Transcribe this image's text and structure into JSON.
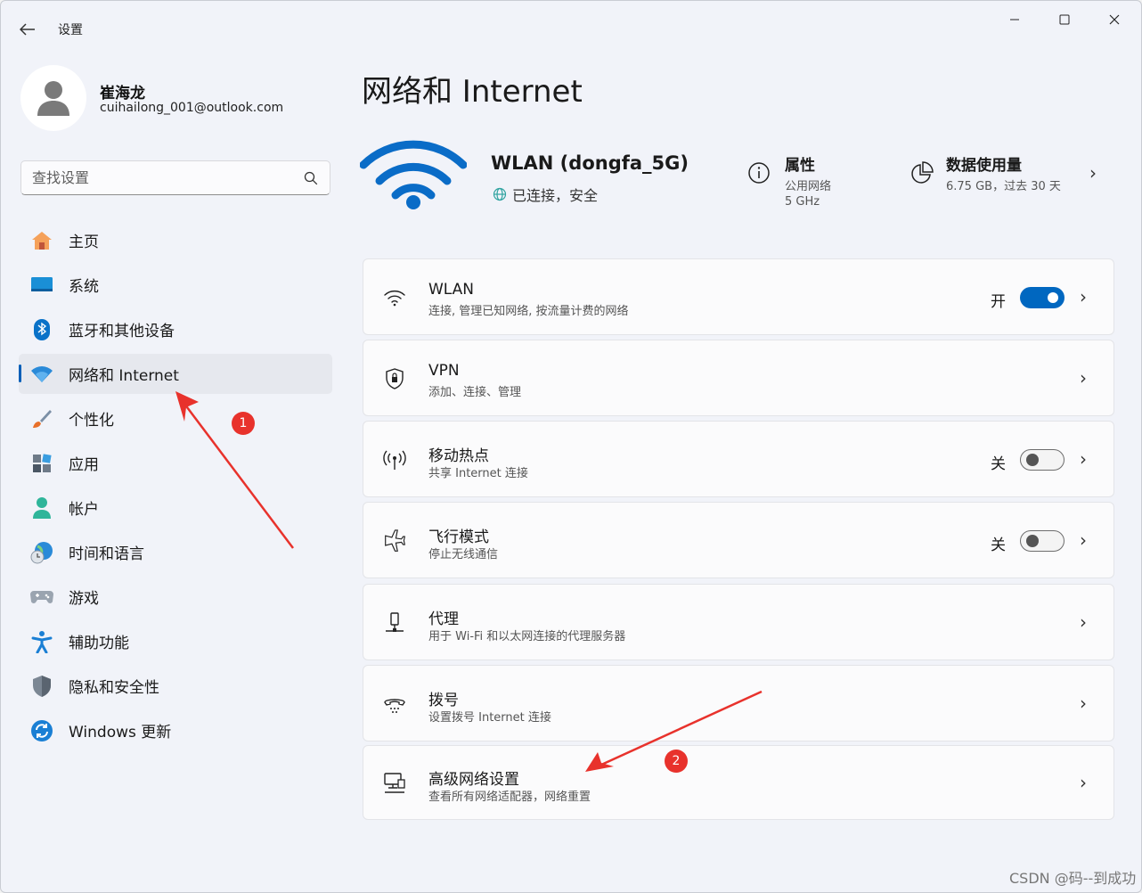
{
  "window": {
    "title": "设置",
    "back_icon": "arrow-left-icon",
    "minimize_icon": "minimize-icon",
    "maximize_icon": "maximize-icon",
    "close_icon": "close-icon"
  },
  "user": {
    "name": "崔海龙",
    "email": "cuihailong_001@outlook.com"
  },
  "search": {
    "placeholder": "查找设置"
  },
  "nav": [
    {
      "label": "主页",
      "icon": "home-icon"
    },
    {
      "label": "系统",
      "icon": "system-icon"
    },
    {
      "label": "蓝牙和其他设备",
      "icon": "bluetooth-icon"
    },
    {
      "label": "网络和 Internet",
      "icon": "network-icon",
      "active": true
    },
    {
      "label": "个性化",
      "icon": "brush-icon"
    },
    {
      "label": "应用",
      "icon": "apps-icon"
    },
    {
      "label": "帐户",
      "icon": "account-icon"
    },
    {
      "label": "时间和语言",
      "icon": "time-language-icon"
    },
    {
      "label": "游戏",
      "icon": "gamepad-icon"
    },
    {
      "label": "辅助功能",
      "icon": "accessibility-icon"
    },
    {
      "label": "隐私和安全性",
      "icon": "shield-icon"
    },
    {
      "label": "Windows 更新",
      "icon": "update-icon"
    }
  ],
  "main": {
    "title": "网络和 Internet",
    "hero": {
      "network_name": "WLAN (dongfa_5G)",
      "status": "已连接，安全",
      "properties_title": "属性",
      "properties_line1": "公用网络",
      "properties_line2": "5 GHz",
      "data_title": "数据使用量",
      "data_line1": "6.75 GB，过去 30 天"
    },
    "cards": [
      {
        "title": "WLAN",
        "subtitle": "连接, 管理已知网络, 按流量计费的网络",
        "state": "开",
        "toggle": "on",
        "icon": "wifi-icon"
      },
      {
        "title": "VPN",
        "subtitle": "添加、连接、管理",
        "icon": "vpn-shield-icon"
      },
      {
        "title": "移动热点",
        "subtitle": "共享 Internet 连接",
        "state": "关",
        "toggle": "off",
        "icon": "hotspot-icon"
      },
      {
        "title": "飞行模式",
        "subtitle": "停止无线通信",
        "state": "关",
        "toggle": "off",
        "icon": "airplane-icon"
      },
      {
        "title": "代理",
        "subtitle": "用于 Wi-Fi 和以太网连接的代理服务器",
        "icon": "proxy-icon"
      },
      {
        "title": "拨号",
        "subtitle": "设置拨号 Internet 连接",
        "icon": "dialup-icon"
      },
      {
        "title": "高级网络设置",
        "subtitle": "查看所有网络适配器，网络重置",
        "icon": "advanced-network-icon"
      }
    ]
  },
  "annotations": {
    "badge1": "1",
    "badge2": "2",
    "arrow_color": "#e8322c"
  },
  "watermark": "CSDN @码--到成功",
  "colors": {
    "accent": "#0067c0",
    "background": "#f1f3f9",
    "card": "#fbfbfc"
  }
}
